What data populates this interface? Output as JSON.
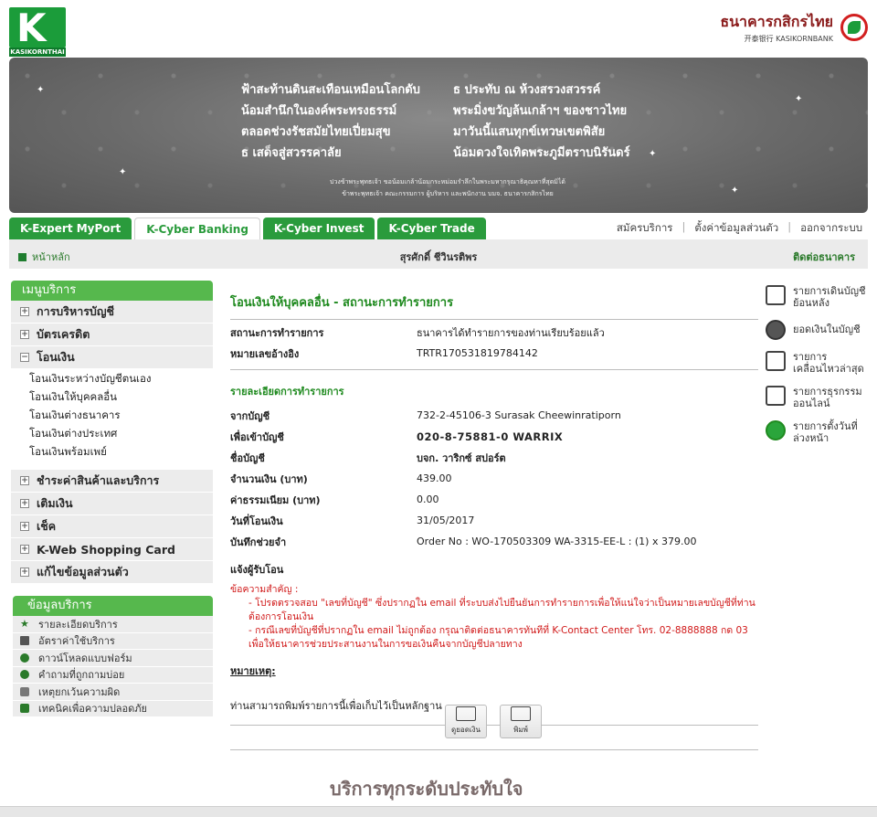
{
  "brand": {
    "left_logo_text": "KASIKORNTHAI",
    "right_th": "ธนาคารกสิกรไทย",
    "right_en": "开泰银行 KASIKORNBANK"
  },
  "banner": {
    "poem_left": [
      "ฟ้าสะท้านดินสะเทือนเหมือนโลกดับ",
      "น้อมสำนึกในองค์พระทรงธรรม์",
      "ตลอดช่วงรัชสมัยไทยเปี่ยมสุข",
      "ธ เสด็จสู่สวรรคาลัย"
    ],
    "poem_right": [
      "ธ ประทับ ณ ห้วงสรวงสวรรค์",
      "พระมิ่งขวัญล้นเกล้าฯ ของชาวไทย",
      "มาวันนี้แสนทุกข์เทวษเขตพิสัย",
      "น้อมดวงใจเทิดพระภูมีตราบนิรันดร์"
    ],
    "dedication": [
      "ปวงข้าพระพุทธเจ้า ขอน้อมเกล้าน้อมกระหม่อมรำลึกในพระมหากรุณาธิคุณหาที่สุดมิได้",
      "ข้าพระพุทธเจ้า คณะกรรมการ ผู้บริหาร และพนักงาน บมจ. ธนาคารกสิกรไทย"
    ]
  },
  "tabs": [
    {
      "label": "K-Expert MyPort",
      "active": false
    },
    {
      "label": "K-Cyber Banking",
      "active": true
    },
    {
      "label": "K-Cyber Invest",
      "active": false
    },
    {
      "label": "K-Cyber Trade",
      "active": false
    }
  ],
  "toplinks": [
    "สมัครบริการ",
    "ตั้งค่าข้อมูลส่วนตัว",
    "ออกจากระบบ"
  ],
  "userbar": {
    "home": "หน้าหลัก",
    "username": "สุรศักดิ์ ชีวินรติพร",
    "contact": "ติดต่อธนาคาร"
  },
  "menu": {
    "title": "เมนูบริการ",
    "items_top": [
      "การบริหารบัญชี",
      "บัตรเครดิต",
      "โอนเงิน"
    ],
    "transfer_sub": [
      "โอนเงินระหว่างบัญชีตนเอง",
      "โอนเงินให้บุคคลอื่น",
      "โอนเงินต่างธนาคาร",
      "โอนเงินต่างประเทศ",
      "โอนเงินพร้อมเพย์"
    ],
    "items_bottom": [
      "ชำระค่าสินค้าและบริการ",
      "เติมเงิน",
      "เช็ค",
      "K-Web Shopping Card",
      "แก้ไขข้อมูลส่วนตัว"
    ],
    "collapse_symbol": "−",
    "expand_symbol": "+"
  },
  "info": {
    "title": "ข้อมูลบริการ",
    "items": [
      "รายละเอียดบริการ",
      "อัตราค่าใช้บริการ",
      "ดาวน์โหลดแบบฟอร์ม",
      "คำถามที่ถูกถามบ่อย",
      "เหตุยกเว้นความผิด",
      "เทคนิคเพื่อความปลอดภัย"
    ]
  },
  "main": {
    "title": "โอนเงินให้บุคคลอื่น - สถานะการทำรายการ",
    "status_label": "สถานะการทำรายการ",
    "status_value": "ธนาคารได้ทำรายการของท่านเรียบร้อยแล้ว",
    "ref_label": "หมายเลขอ้างอิง",
    "ref_value": "TRTR170531819784142",
    "details_title": "รายละเอียดการทำรายการ",
    "from_label": "จากบัญชี",
    "from_value": "732-2-45106-3 Surasak Cheewinratiporn",
    "to_label": "เพื่อเข้าบัญชี",
    "to_value": "020-8-75881-0 WARRIX",
    "name_label": "ชื่อบัญชี",
    "name_value": "บจก. วาริกซ์ สปอร์ต",
    "amount_label": "จำนวนเงิน (บาท)",
    "amount_value": "439.00",
    "fee_label": "ค่าธรรมเนียม (บาท)",
    "fee_value": "0.00",
    "date_label": "วันที่โอนเงิน",
    "date_value": "31/05/2017",
    "memo_label": "บันทึกช่วยจำ",
    "memo_value": "Order No : WO-170503309 WA-3315-EE-L : (1) x 379.00",
    "notify_label": "แจ้งผู้รับโอน",
    "important_head": "ข้อความสำคัญ :",
    "important_1": "- โปรดตรวจสอบ \"เลขที่บัญชี\" ซึ่งปรากฏใน email ที่ระบบส่งไปยืนยันการทำรายการเพื่อให้แน่ใจว่าเป็นหมายเลขบัญชีที่ท่านต้องการโอนเงิน",
    "important_2": "- กรณีเลขที่บัญชีที่ปรากฏใน email ไม่ถูกต้อง กรุณาติดต่อธนาคารทันทีที่ K-Contact Center โทร. 02-8888888 กด 03 เพื่อให้ธนาคารช่วยประสานงานในการขอเงินคืนจากบัญชีปลายทาง",
    "note_head": "หมายเหตุ:",
    "note_text": "ท่านสามารถพิมพ์รายการนี้เพื่อเก็บไว้เป็นหลักฐาน"
  },
  "actions": {
    "check_balance": "ดูยอดเงิน",
    "print": "พิมพ์"
  },
  "quick": [
    {
      "icon": "statement-icon",
      "label": "รายการเดินบัญชีย้อนหลัง"
    },
    {
      "icon": "balance-icon",
      "label": "ยอดเงินในบัญชี"
    },
    {
      "icon": "recent-icon",
      "label": "รายการเคลื่อนไหวล่าสุด"
    },
    {
      "icon": "online-icon",
      "label": "รายการธุรกรรมออนไลน์"
    },
    {
      "icon": "clock-icon",
      "label": "รายการตั้งวันที่ล่วงหน้า"
    }
  ],
  "footer": {
    "slogan": "บริการทุกระดับประทับใจ"
  },
  "colors": {
    "brand_green": "#2a9b3c",
    "title_green": "#1f8a1f",
    "alert_red": "#d01818"
  }
}
